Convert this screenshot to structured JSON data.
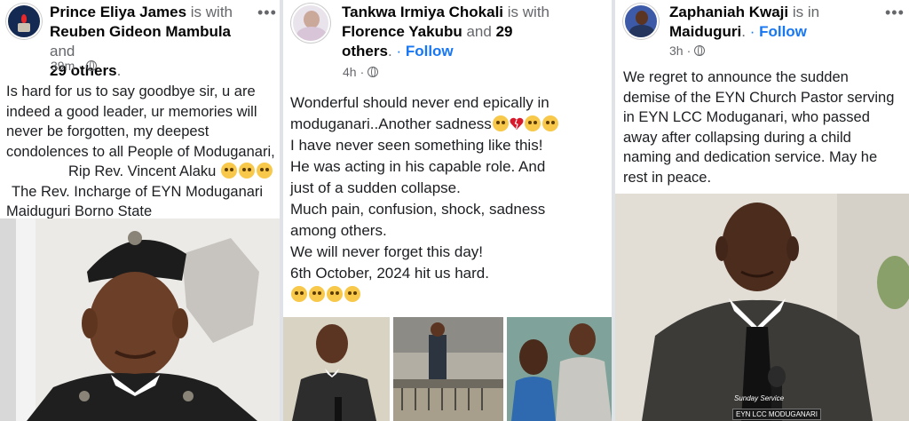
{
  "posts": [
    {
      "author": "Prince Eliya James",
      "with_text": "is with",
      "tagged": "Reuben Gideon Mambula",
      "and_text": "and",
      "others": "29 others",
      "time": "39m",
      "lines": [
        "Is hard for us to say goodbye sir, u are",
        "indeed a good leader, ur memories will",
        "never be forgotten, my deepest",
        "condolences to all People of Moduganari,",
        "Rip Rev. Vincent Alaku",
        "The Rev. Incharge of EYN Moduganari",
        "Maiduguri Borno State"
      ]
    },
    {
      "author": "Tankwa Irmiya Chokali",
      "with_text": "is with",
      "tagged": "Florence Yakubu",
      "and_text": "and",
      "others": "29 others",
      "follow": "Follow",
      "time": "4h",
      "lines": [
        "Wonderful should never end epically in",
        "moduganari..Another sadness",
        "I have never seen something like this!",
        "He was acting in his capable role. And",
        "just of a sudden collapse.",
        "Much pain, confusion, shock, sadness",
        "among others.",
        "We will never forget this day!",
        "6th October, 2024 hit us hard."
      ]
    },
    {
      "author": "Zaphaniah Kwaji",
      "in_text": "is in",
      "location": "Maiduguri",
      "follow": "Follow",
      "time": "3h",
      "lines": [
        "We regret to announce the sudden",
        "demise of the EYN Church Pastor serving",
        "in EYN LCC Moduganari, who passed",
        "away after collapsing during a child",
        "naming and dedication service. May he",
        "rest in peace."
      ],
      "watermark_top": "Sunday Service",
      "watermark_sign": "EYN LCC MODUGANARI"
    }
  ],
  "colors": {
    "follow": "#1877f2",
    "secondary": "#65676b"
  }
}
